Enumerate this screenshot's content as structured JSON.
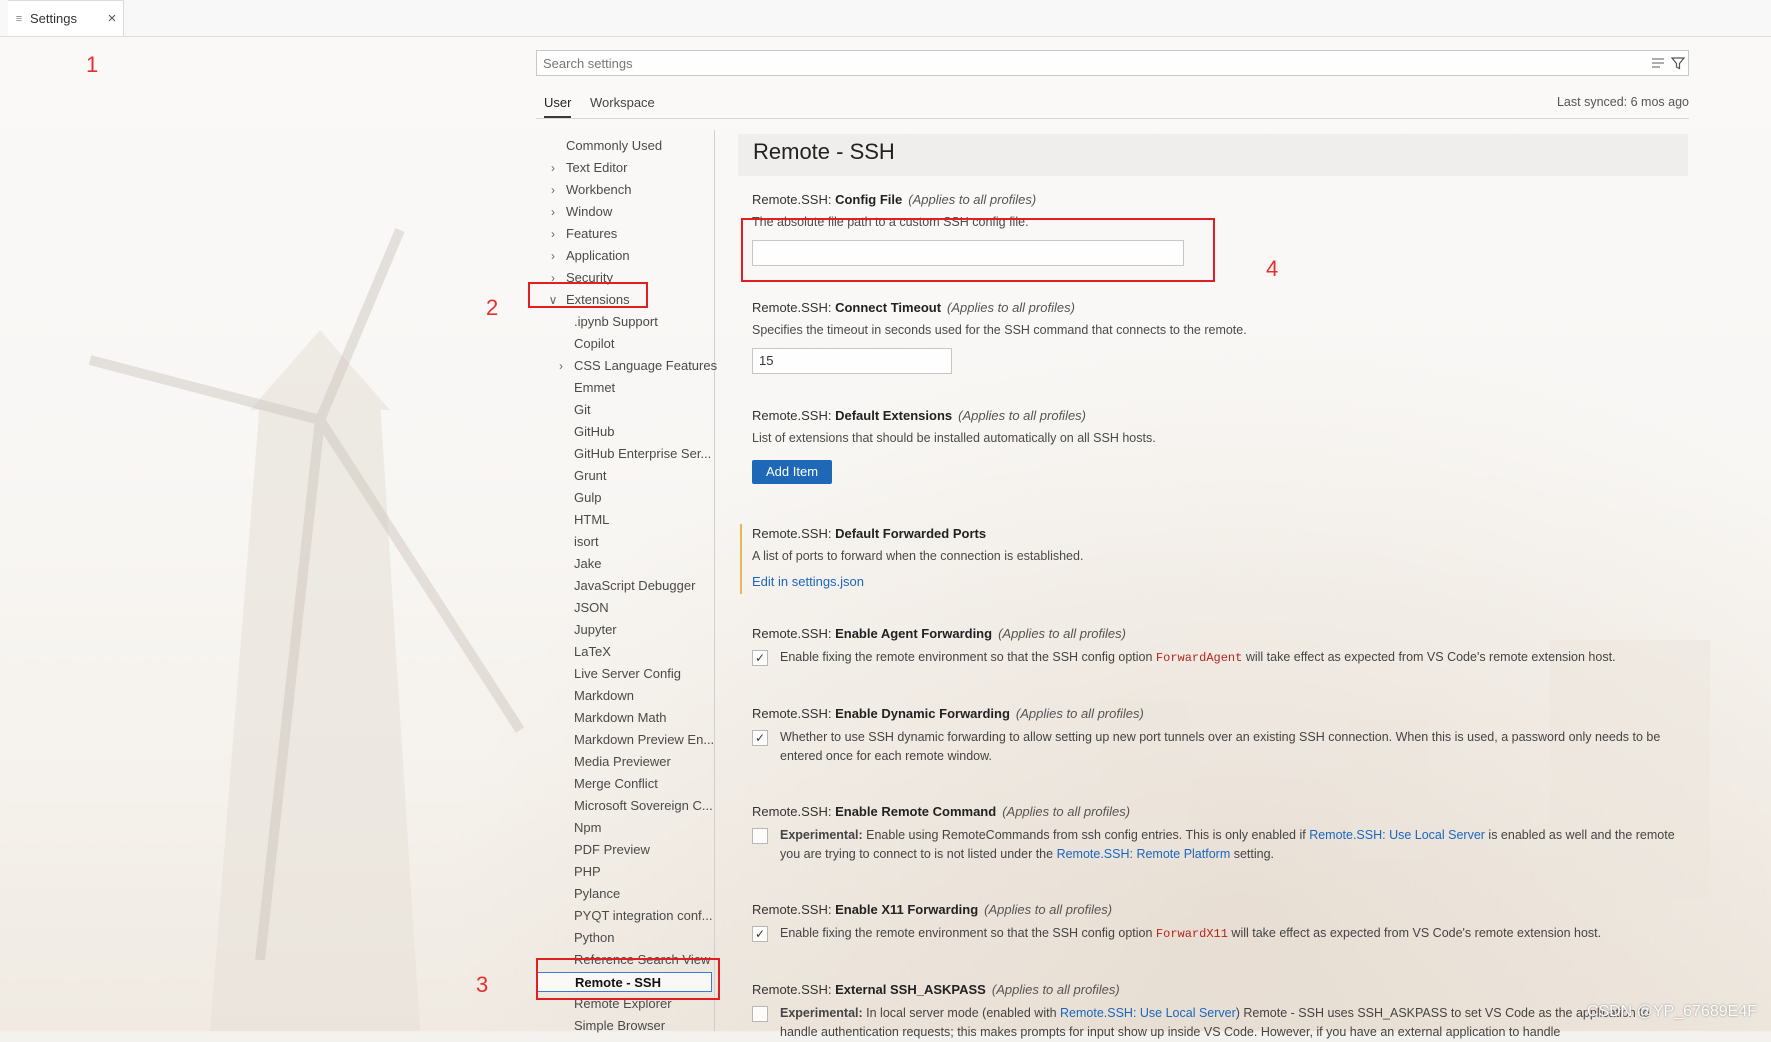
{
  "tab": {
    "label": "Settings",
    "close": "×"
  },
  "search": {
    "placeholder": "Search settings"
  },
  "scopes": {
    "user": "User",
    "workspace": "Workspace",
    "last_synced": "Last synced: 6 mos ago"
  },
  "toc": [
    {
      "label": "Commonly Used",
      "level": 0,
      "chevron": ""
    },
    {
      "label": "Text Editor",
      "level": 0,
      "chevron": "›"
    },
    {
      "label": "Workbench",
      "level": 0,
      "chevron": "›"
    },
    {
      "label": "Window",
      "level": 0,
      "chevron": "›"
    },
    {
      "label": "Features",
      "level": 0,
      "chevron": "›"
    },
    {
      "label": "Application",
      "level": 0,
      "chevron": "›"
    },
    {
      "label": "Security",
      "level": 0,
      "chevron": "›"
    },
    {
      "label": "Extensions",
      "level": 0,
      "chevron": "∨"
    },
    {
      "label": ".ipynb Support",
      "level": 1,
      "chevron": ""
    },
    {
      "label": "Copilot",
      "level": 1,
      "chevron": ""
    },
    {
      "label": "CSS Language Features",
      "level": 1,
      "chevron": "›"
    },
    {
      "label": "Emmet",
      "level": 1,
      "chevron": ""
    },
    {
      "label": "Git",
      "level": 1,
      "chevron": ""
    },
    {
      "label": "GitHub",
      "level": 1,
      "chevron": ""
    },
    {
      "label": "GitHub Enterprise Ser...",
      "level": 1,
      "chevron": ""
    },
    {
      "label": "Grunt",
      "level": 1,
      "chevron": ""
    },
    {
      "label": "Gulp",
      "level": 1,
      "chevron": ""
    },
    {
      "label": "HTML",
      "level": 1,
      "chevron": ""
    },
    {
      "label": "isort",
      "level": 1,
      "chevron": ""
    },
    {
      "label": "Jake",
      "level": 1,
      "chevron": ""
    },
    {
      "label": "JavaScript Debugger",
      "level": 1,
      "chevron": ""
    },
    {
      "label": "JSON",
      "level": 1,
      "chevron": ""
    },
    {
      "label": "Jupyter",
      "level": 1,
      "chevron": ""
    },
    {
      "label": "LaTeX",
      "level": 1,
      "chevron": ""
    },
    {
      "label": "Live Server Config",
      "level": 1,
      "chevron": ""
    },
    {
      "label": "Markdown",
      "level": 1,
      "chevron": ""
    },
    {
      "label": "Markdown Math",
      "level": 1,
      "chevron": ""
    },
    {
      "label": "Markdown Preview En...",
      "level": 1,
      "chevron": ""
    },
    {
      "label": "Media Previewer",
      "level": 1,
      "chevron": ""
    },
    {
      "label": "Merge Conflict",
      "level": 1,
      "chevron": ""
    },
    {
      "label": "Microsoft Sovereign C...",
      "level": 1,
      "chevron": ""
    },
    {
      "label": "Npm",
      "level": 1,
      "chevron": ""
    },
    {
      "label": "PDF Preview",
      "level": 1,
      "chevron": ""
    },
    {
      "label": "PHP",
      "level": 1,
      "chevron": ""
    },
    {
      "label": "Pylance",
      "level": 1,
      "chevron": ""
    },
    {
      "label": "PYQT integration conf...",
      "level": 1,
      "chevron": ""
    },
    {
      "label": "Python",
      "level": 1,
      "chevron": ""
    },
    {
      "label": "Reference Search View",
      "level": 1,
      "chevron": ""
    },
    {
      "label": "Remote - SSH",
      "level": 1,
      "chevron": "",
      "selected": true
    },
    {
      "label": "Remote Explorer",
      "level": 1,
      "chevron": ""
    },
    {
      "label": "Simple Browser",
      "level": 1,
      "chevron": ""
    }
  ],
  "panel": {
    "title": "Remote - SSH",
    "scope_note": "(Applies to all profiles)",
    "config_file": {
      "prefix": "Remote.SSH: ",
      "name": "Config File",
      "desc": "The absolute file path to a custom SSH config file.",
      "value": ""
    },
    "connect_timeout": {
      "prefix": "Remote.SSH: ",
      "name": "Connect Timeout",
      "desc": "Specifies the timeout in seconds used for the SSH command that connects to the remote.",
      "value": "15"
    },
    "default_extensions": {
      "prefix": "Remote.SSH: ",
      "name": "Default Extensions",
      "desc": "List of extensions that should be installed automatically on all SSH hosts.",
      "button": "Add Item"
    },
    "forwarded_ports": {
      "prefix": "Remote.SSH: ",
      "name": "Default Forwarded Ports",
      "desc": "A list of ports to forward when the connection is established.",
      "link": "Edit in settings.json"
    },
    "agent_forwarding": {
      "prefix": "Remote.SSH: ",
      "name": "Enable Agent Forwarding",
      "desc_a": "Enable fixing the remote environment so that the SSH config option ",
      "code": "ForwardAgent",
      "desc_b": " will take effect as expected from VS Code's remote extension host.",
      "checked": true
    },
    "dynamic_forwarding": {
      "prefix": "Remote.SSH: ",
      "name": "Enable Dynamic Forwarding",
      "desc": "Whether to use SSH dynamic forwarding to allow setting up new port tunnels over an existing SSH connection. When this is used, a password only needs to be entered once for each remote window.",
      "checked": true
    },
    "remote_command": {
      "prefix": "Remote.SSH: ",
      "name": "Enable Remote Command",
      "exp": "Experimental:",
      "desc_a": " Enable using RemoteCommands from ssh config entries. This is only enabled if ",
      "link_a": "Remote.SSH: Use Local Server",
      "desc_b": " is enabled as well and the remote you are trying to connect to is not listed under the ",
      "link_b": "Remote.SSH: Remote Platform",
      "desc_c": " setting.",
      "checked": false
    },
    "x11_forwarding": {
      "prefix": "Remote.SSH: ",
      "name": "Enable X11 Forwarding",
      "desc_a": "Enable fixing the remote environment so that the SSH config option ",
      "code": "ForwardX11",
      "desc_b": " will take effect as expected from VS Code's remote extension host.",
      "checked": true
    },
    "askpass": {
      "prefix": "Remote.SSH: ",
      "name": "External SSH_ASKPASS",
      "exp": "Experimental:",
      "desc_a": " In local server mode (enabled with ",
      "link_a": "Remote.SSH: Use Local Server",
      "desc_b": ") Remote - SSH uses SSH_ASKPASS to set VS Code as the application to handle authentication requests; this makes prompts for input show up inside VS Code. However, if you have an external application to handle",
      "checked": false
    }
  },
  "annotations": {
    "n1": "1",
    "n2": "2",
    "n3": "3",
    "n4": "4"
  },
  "watermark": "CSDN @YP_67689E4F",
  "colors": {
    "accent": "#1f68b8",
    "annotation": "#e02020",
    "link": "#1a66c0"
  }
}
